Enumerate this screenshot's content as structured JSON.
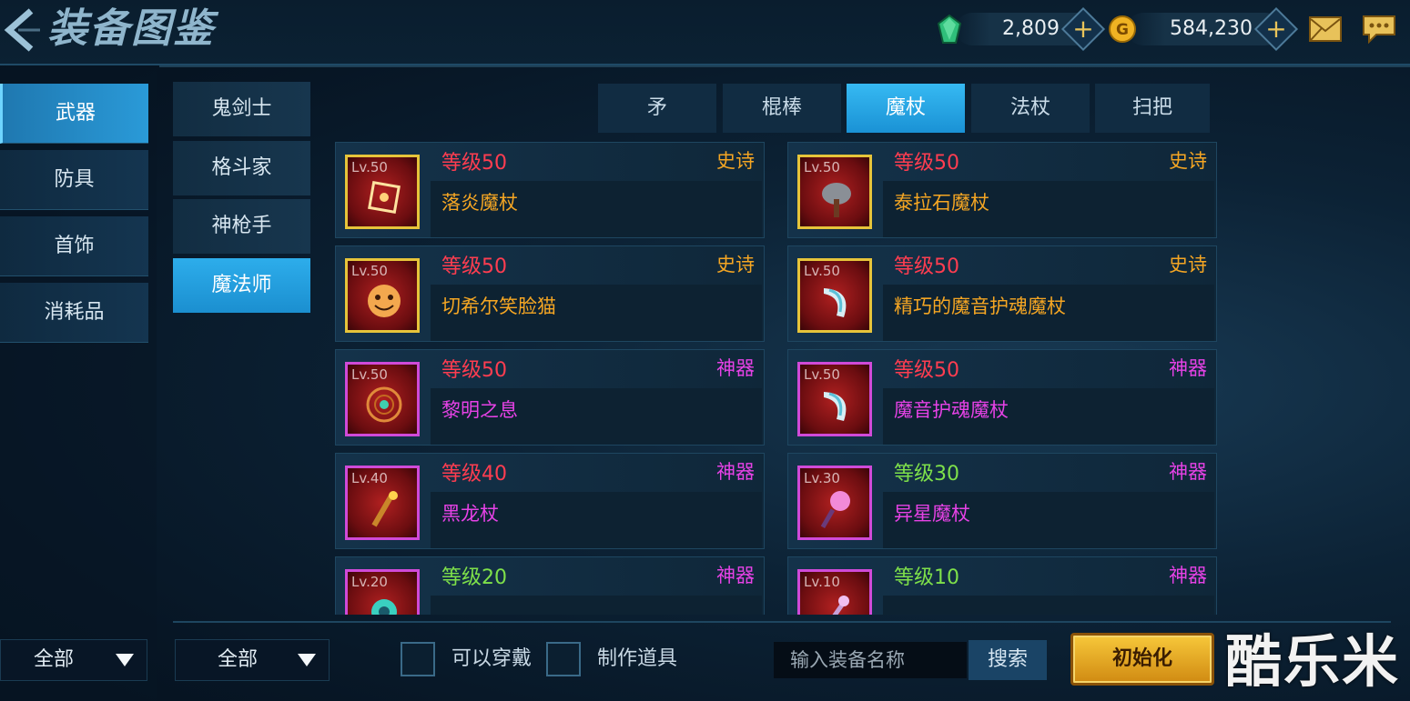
{
  "header": {
    "title": "装备图鉴",
    "gems": "2,809",
    "gold": "584,230"
  },
  "categories": [
    {
      "label": "武器",
      "active": true
    },
    {
      "label": "防具",
      "active": false
    },
    {
      "label": "首饰",
      "active": false
    },
    {
      "label": "消耗品",
      "active": false
    }
  ],
  "classes": [
    {
      "label": "鬼剑士",
      "active": false
    },
    {
      "label": "格斗家",
      "active": false
    },
    {
      "label": "神枪手",
      "active": false
    },
    {
      "label": "魔法师",
      "active": true
    }
  ],
  "weapon_tabs": [
    {
      "label": "矛",
      "active": false
    },
    {
      "label": "棍棒",
      "active": false
    },
    {
      "label": "魔杖",
      "active": true
    },
    {
      "label": "法杖",
      "active": false
    },
    {
      "label": "扫把",
      "active": false
    }
  ],
  "items": [
    {
      "lv_badge": "Lv.50",
      "level_text": "等级50",
      "level_color": "#ff3d50",
      "rarity": "史诗",
      "rarity_color": "#f5a623",
      "name": "落炎魔杖",
      "name_color": "#f5a623",
      "frame_color": "#e6c43a",
      "icon": "fire-staff-icon"
    },
    {
      "lv_badge": "Lv.50",
      "level_text": "等级50",
      "level_color": "#ff3d50",
      "rarity": "史诗",
      "rarity_color": "#f5a623",
      "name": "泰拉石魔杖",
      "name_color": "#f5a623",
      "frame_color": "#e6c43a",
      "icon": "stone-staff-icon"
    },
    {
      "lv_badge": "Lv.50",
      "level_text": "等级50",
      "level_color": "#ff3d50",
      "rarity": "史诗",
      "rarity_color": "#f5a623",
      "name": "切希尔笑脸猫",
      "name_color": "#f5a623",
      "frame_color": "#e6c43a",
      "icon": "cat-face-icon"
    },
    {
      "lv_badge": "Lv.50",
      "level_text": "等级50",
      "level_color": "#ff3d50",
      "rarity": "史诗",
      "rarity_color": "#f5a623",
      "name": "精巧的魔音护魂魔杖",
      "name_color": "#f5a623",
      "frame_color": "#e6c43a",
      "icon": "horn-staff-icon"
    },
    {
      "lv_badge": "Lv.50",
      "level_text": "等级50",
      "level_color": "#ff3d50",
      "rarity": "神器",
      "rarity_color": "#e642e6",
      "name": "黎明之息",
      "name_color": "#e642e6",
      "frame_color": "#d04ad8",
      "icon": "orb-ring-icon"
    },
    {
      "lv_badge": "Lv.50",
      "level_text": "等级50",
      "level_color": "#ff3d50",
      "rarity": "神器",
      "rarity_color": "#e642e6",
      "name": "魔音护魂魔杖",
      "name_color": "#e642e6",
      "frame_color": "#d04ad8",
      "icon": "horn-staff-icon"
    },
    {
      "lv_badge": "Lv.40",
      "level_text": "等级40",
      "level_color": "#ff3d50",
      "rarity": "神器",
      "rarity_color": "#e642e6",
      "name": "黑龙杖",
      "name_color": "#e642e6",
      "frame_color": "#d04ad8",
      "icon": "dragon-staff-icon"
    },
    {
      "lv_badge": "Lv.30",
      "level_text": "等级30",
      "level_color": "#7ee04a",
      "rarity": "神器",
      "rarity_color": "#e642e6",
      "name": "异星魔杖",
      "name_color": "#e642e6",
      "frame_color": "#d04ad8",
      "icon": "star-staff-icon"
    },
    {
      "lv_badge": "Lv.20",
      "level_text": "等级20",
      "level_color": "#7ee04a",
      "rarity": "神器",
      "rarity_color": "#e642e6",
      "name": "",
      "name_color": "#e642e6",
      "frame_color": "#d04ad8",
      "icon": "gem-staff-icon"
    },
    {
      "lv_badge": "Lv.10",
      "level_text": "等级10",
      "level_color": "#7ee04a",
      "rarity": "神器",
      "rarity_color": "#e642e6",
      "name": "",
      "name_color": "#e642e6",
      "frame_color": "#d04ad8",
      "icon": "wand-icon"
    }
  ],
  "filters": {
    "category_filter": "全部",
    "class_filter": "全部",
    "wearable_label": "可以穿戴",
    "craftable_label": "制作道具",
    "search_placeholder": "输入装备名称",
    "search_button": "搜索",
    "reset_button": "初始化"
  },
  "watermark": "酷乐米"
}
